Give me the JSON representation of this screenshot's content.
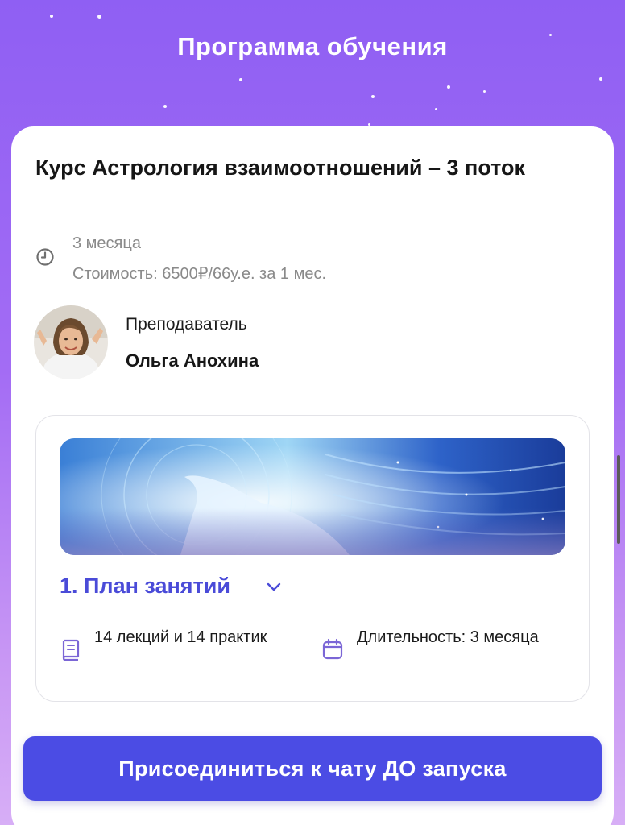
{
  "header": {
    "title": "Программа обучения"
  },
  "course": {
    "title": "Курс Астрология взаимоотношений – 3 поток",
    "duration": "3 месяца",
    "price": "Стоимость: 6500₽/66у.е. за 1 мес."
  },
  "teacher": {
    "label": "Преподаватель",
    "name": "Ольга Анохина"
  },
  "module": {
    "title": "1. План занятий",
    "lectures": "14 лекций и 14 практик",
    "length": "Длительность: 3 месяца"
  },
  "cta": {
    "label": "Присоединиться к чату ДО запуска"
  },
  "icons": [
    "clock-icon",
    "chevron-down-icon",
    "book-icon",
    "calendar-icon"
  ],
  "colors": {
    "accent": "#4b4ce4",
    "module_title": "#4a4bd8",
    "background_top": "#8f5ff3",
    "background_bottom": "#d7aef6"
  }
}
